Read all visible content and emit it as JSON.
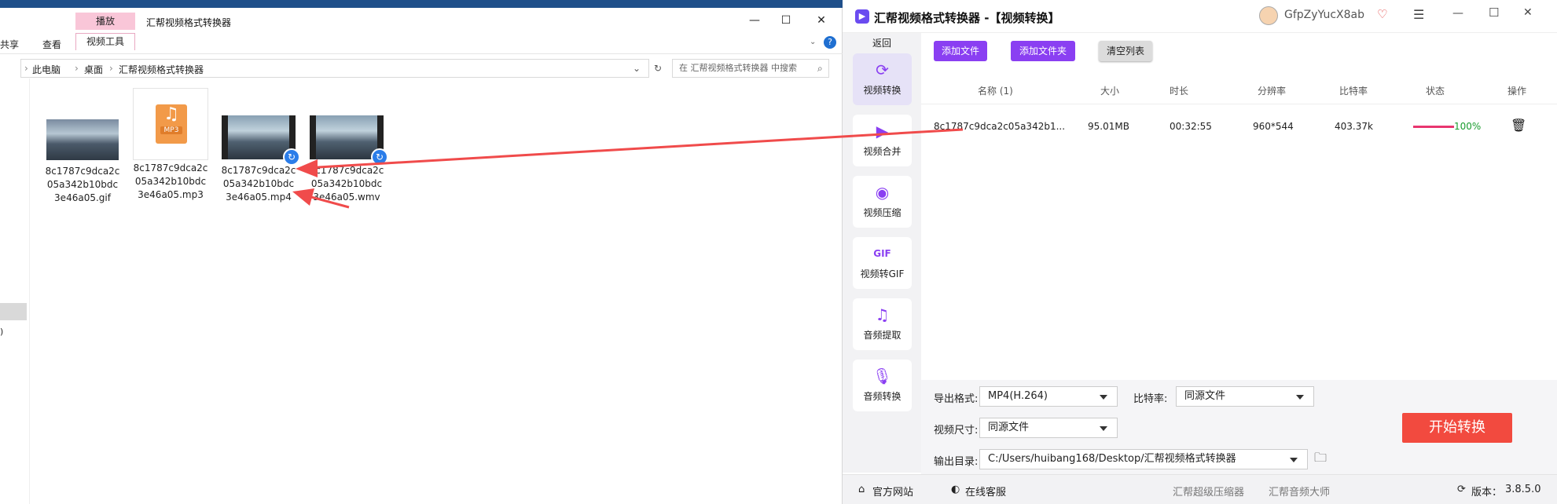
{
  "explorer": {
    "title": "汇帮视频格式转换器",
    "context_tab": "播放",
    "ribbon_tabs": [
      "共享",
      "查看",
      "视频工具"
    ],
    "window_controls": [
      "—",
      "☐",
      "✕"
    ],
    "address": [
      "此电脑",
      "桌面",
      "汇帮视频格式转换器"
    ],
    "search_placeholder": "在 汇帮视频格式转换器 中搜索",
    "files": [
      {
        "name": "8c1787c9dca2c 05a342b10bdc 3e46a05.gif",
        "line1": "8c1787c9dca2c",
        "line2": "05a342b10bdc",
        "line3": "3e46a05.gif",
        "type": "gif"
      },
      {
        "name": "8c1787c9dca2c 05a342b10bdc 3e46a05.mp3",
        "line1": "8c1787c9dca2c",
        "line2": "05a342b10bdc",
        "line3": "3e46a05.mp3",
        "type": "mp3",
        "icon_label": "MP3"
      },
      {
        "name": "8c1787c9dca2c 05a342b10bdc 3e46a05.mp4",
        "line1": "8c1787c9dca2c",
        "line2": "05a342b10bdc",
        "line3": "3e46a05.mp4",
        "type": "mp4"
      },
      {
        "name": "8c1787c9dca2c 05a342b10bdc 3e46a05.wmv",
        "line1": "8c1787c9dca2c",
        "line2": "05a342b10bdc",
        "line3": "3e46a05.wmv",
        "type": "wmv"
      }
    ]
  },
  "app": {
    "title": "汇帮视频格式转换器 -【视频转换】",
    "user": "GfpZyYucX8ab",
    "back": "返回",
    "sidebar": [
      "视频转换",
      "视频合并",
      "视频压缩",
      "视频转GIF",
      "音频提取",
      "音频转换"
    ],
    "toolbar": {
      "add_file": "添加文件",
      "add_folder": "添加文件夹",
      "clear_list": "清空列表"
    },
    "table": {
      "headers": [
        "名称 (1)",
        "大小",
        "时长",
        "分辨率",
        "比特率",
        "状态",
        "操作"
      ],
      "rows": [
        {
          "name": "8c1787c9dca2c05a342b1...",
          "size": "95.01MB",
          "duration": "00:32:55",
          "resolution": "960*544",
          "bitrate": "403.37k",
          "progress": "100%",
          "progress_value": 1.0
        }
      ]
    },
    "settings": {
      "format_label": "导出格式:",
      "format_value": "MP4(H.264)",
      "bitrate_label": "比特率:",
      "bitrate_value": "同源文件",
      "size_label": "视频尺寸:",
      "size_value": "同源文件",
      "output_label": "输出目录:",
      "output_value": "C:/Users/huibang168/Desktop/汇帮视频格式转换器"
    },
    "start_button": "开始转换",
    "footer": {
      "website": "官方网站",
      "support": "在线客服",
      "compressor": "汇帮超级压缩器",
      "audio_master": "汇帮音频大师",
      "version_label": "版本：",
      "version": "3.8.5.0"
    },
    "colors": {
      "accent": "#8a3ff2",
      "start": "#f24a3f",
      "progress": "#e8366f",
      "arrow": "#f04b4b"
    }
  }
}
